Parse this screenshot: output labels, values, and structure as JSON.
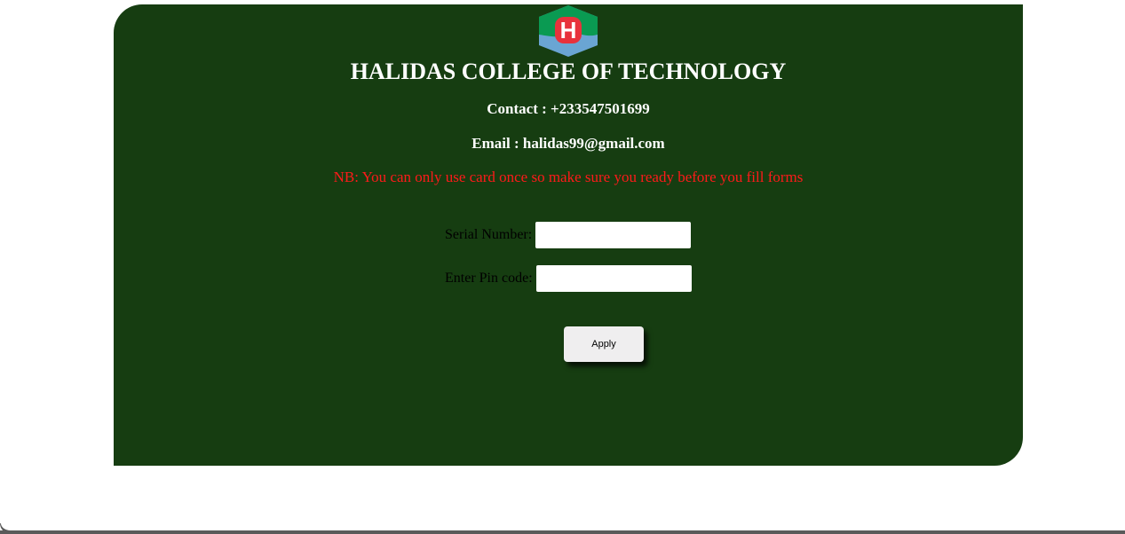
{
  "header": {
    "logo_letter": "H",
    "title": "HALIDAS COLLEGE OF TECHNOLOGY",
    "contact": "Contact : +233547501699",
    "email": "Email : halidas99@gmail.com"
  },
  "notice": "NB: You can only use card once so make sure you ready before you fill forms",
  "form": {
    "serial_label": "Serial Number:",
    "serial_value": "",
    "pin_label": "Enter Pin code:",
    "pin_value": "",
    "apply_label": "Apply"
  },
  "colors": {
    "panel_background": "#163d11",
    "notice_text": "#ff1a1a",
    "logo_green": "#0a9a52",
    "logo_blue": "#6aa5d3",
    "logo_red": "#e8323c"
  }
}
